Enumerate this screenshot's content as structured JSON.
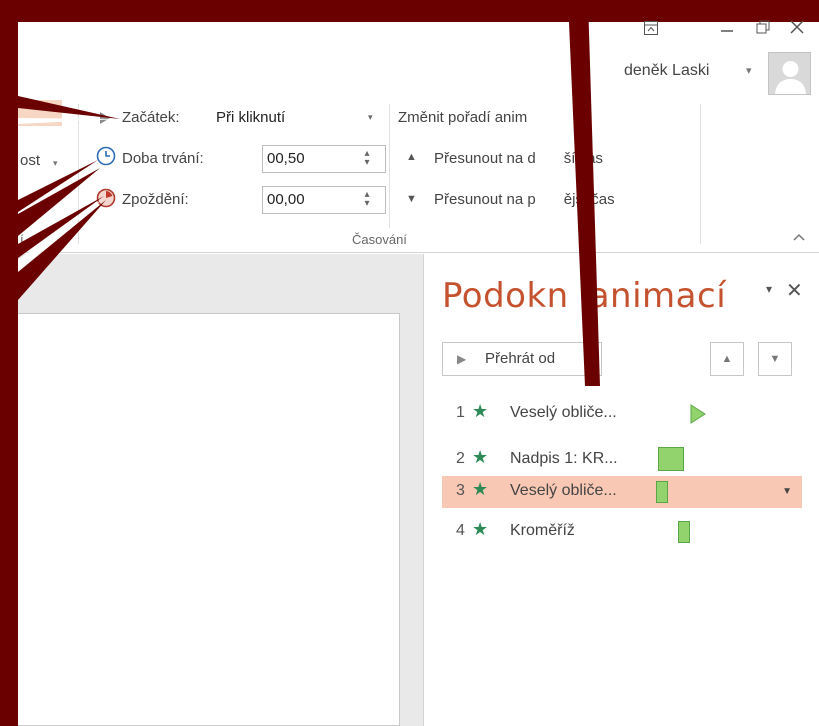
{
  "titlebar": {
    "controls": [
      "ribbon-display-icon",
      "minimize-icon",
      "restore-icon",
      "close-icon"
    ],
    "user_name": "deněk Laski",
    "user_caret": "▾"
  },
  "ribbon": {
    "partial_effects_label": "ost",
    "start_label": "Začátek:",
    "start_value": "Při kliknutí",
    "duration_label": "Doba trvání:",
    "duration_value": "00,50",
    "delay_label": "Zpoždění:",
    "delay_value": "00,00",
    "reorder_title": "Změnit pořadí anim",
    "move_earlier": "Přesunout na d",
    "move_earlier_tail": "ší čas",
    "move_later": "Přesunout na p",
    "move_later_tail": "ější čas",
    "group_label": "Časování",
    "partial_group_label": "í"
  },
  "pane": {
    "title_a": "Podokn",
    "title_b": "animací",
    "play_label": "Přehrát od",
    "items": [
      {
        "num": "1",
        "label": "Veselý obliče..."
      },
      {
        "num": "2",
        "label": "Nadpis 1: KR..."
      },
      {
        "num": "3",
        "label": "Veselý obliče..."
      },
      {
        "num": "4",
        "label": "Kroměříž"
      }
    ]
  },
  "colors": {
    "annotation": "#6b0000",
    "pane_title": "#c5522e",
    "selected_row": "#f8c8b4",
    "timeline_bar": "#92d36e"
  }
}
